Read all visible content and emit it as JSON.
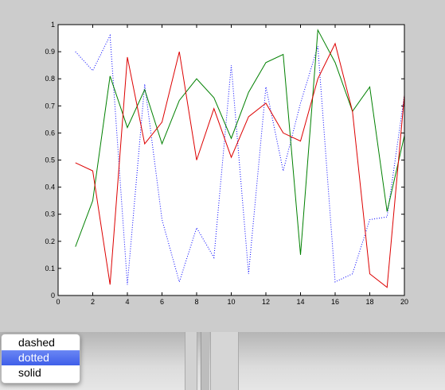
{
  "line_style_menu": {
    "options": [
      "dashed",
      "dotted",
      "solid"
    ],
    "selected": "dotted"
  },
  "chart_data": {
    "type": "line",
    "title": "",
    "xlabel": "",
    "ylabel": "",
    "xlim": [
      0,
      20
    ],
    "ylim": [
      0,
      1
    ],
    "x_ticks": [
      "0",
      "2",
      "4",
      "6",
      "8",
      "10",
      "12",
      "14",
      "16",
      "18",
      "20"
    ],
    "y_ticks": [
      "0",
      "0.1",
      "0.2",
      "0.3",
      "0.4",
      "0.5",
      "0.6",
      "0.7",
      "0.8",
      "0.9",
      "1"
    ],
    "grid": false,
    "legend": "none",
    "x": [
      1,
      2,
      3,
      4,
      5,
      6,
      7,
      8,
      9,
      10,
      11,
      12,
      13,
      14,
      15,
      16,
      17,
      18,
      19,
      20
    ],
    "series": [
      {
        "color": "#0000ff",
        "style": "dotted",
        "values": [
          0.9,
          0.83,
          0.96,
          0.04,
          0.78,
          0.28,
          0.05,
          0.25,
          0.14,
          0.85,
          0.08,
          0.77,
          0.46,
          0.71,
          0.92,
          0.05,
          0.08,
          0.28,
          0.29,
          0.74
        ]
      },
      {
        "color": "#008000",
        "style": "solid",
        "values": [
          0.18,
          0.35,
          0.81,
          0.62,
          0.76,
          0.56,
          0.72,
          0.8,
          0.73,
          0.58,
          0.75,
          0.86,
          0.89,
          0.15,
          0.98,
          0.86,
          0.68,
          0.77,
          0.31,
          0.59
        ]
      },
      {
        "color": "#dd0000",
        "style": "solid",
        "values": [
          0.49,
          0.46,
          0.04,
          0.88,
          0.56,
          0.64,
          0.9,
          0.5,
          0.69,
          0.51,
          0.66,
          0.71,
          0.6,
          0.57,
          0.8,
          0.93,
          0.68,
          0.08,
          0.03,
          0.74
        ]
      }
    ]
  }
}
